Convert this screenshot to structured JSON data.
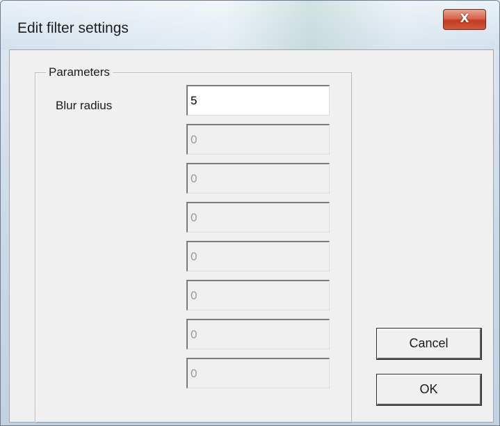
{
  "window": {
    "title": "Edit filter settings",
    "close_label": "X"
  },
  "parameters": {
    "group_label": "Parameters",
    "blur_radius_label": "Blur radius",
    "fields": [
      {
        "value": "5",
        "enabled": true
      },
      {
        "value": "0",
        "enabled": false
      },
      {
        "value": "0",
        "enabled": false
      },
      {
        "value": "0",
        "enabled": false
      },
      {
        "value": "0",
        "enabled": false
      },
      {
        "value": "0",
        "enabled": false
      },
      {
        "value": "0",
        "enabled": false
      },
      {
        "value": "0",
        "enabled": false
      }
    ]
  },
  "buttons": {
    "cancel_label": "Cancel",
    "ok_label": "OK"
  }
}
